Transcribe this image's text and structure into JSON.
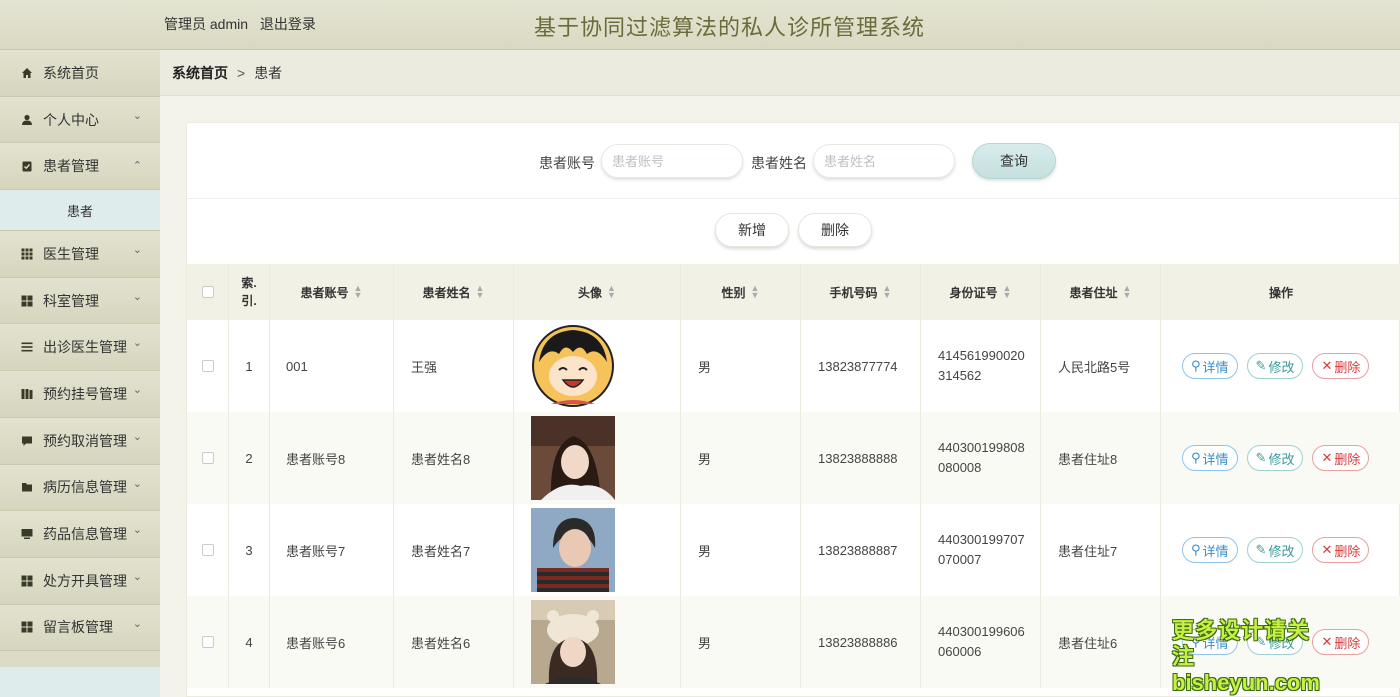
{
  "header": {
    "user_prefix": "管理员 admin",
    "logout": "退出登录",
    "title": "基于协同过滤算法的私人诊所管理系统"
  },
  "sidebar": {
    "items": [
      {
        "label": "系统首页",
        "icon": "home-icon"
      },
      {
        "label": "个人中心",
        "icon": "user-icon"
      },
      {
        "label": "患者管理",
        "icon": "clipboard-icon",
        "expanded": true,
        "sub": "患者"
      },
      {
        "label": "医生管理",
        "icon": "grid-icon"
      },
      {
        "label": "科室管理",
        "icon": "apps-icon"
      },
      {
        "label": "出诊医生管理",
        "icon": "list-icon"
      },
      {
        "label": "预约挂号管理",
        "icon": "book-icon"
      },
      {
        "label": "预约取消管理",
        "icon": "chat-icon"
      },
      {
        "label": "病历信息管理",
        "icon": "folder-icon"
      },
      {
        "label": "药品信息管理",
        "icon": "monitor-icon"
      },
      {
        "label": "处方开具管理",
        "icon": "apps-icon"
      },
      {
        "label": "留言板管理",
        "icon": "apps-icon"
      }
    ]
  },
  "breadcrumb": {
    "home": "系统首页",
    "separator": ">",
    "current": "患者"
  },
  "search": {
    "account_label": "患者账号",
    "account_placeholder": "患者账号",
    "name_label": "患者姓名",
    "name_placeholder": "患者姓名",
    "query_button": "查询"
  },
  "actions": {
    "add": "新增",
    "delete": "删除"
  },
  "table": {
    "columns": [
      "索.\n引.",
      "患者账号",
      "患者姓名",
      "头像",
      "性别",
      "手机号码",
      "身份证号",
      "患者住址",
      "操作"
    ],
    "op_labels": {
      "detail": "详情",
      "edit": "修改",
      "delete": "删除"
    },
    "rows": [
      {
        "index": "1",
        "account": "001",
        "name": "王强",
        "avatar": "cartoon-boy-avatar",
        "gender": "男",
        "phone": "13823877774",
        "id_line1": "414561990020",
        "id_line2": "314562",
        "address": "人民北路5号"
      },
      {
        "index": "2",
        "account": "患者账号8",
        "name": "患者姓名8",
        "avatar": "photo-girl-avatar",
        "gender": "男",
        "phone": "13823888888",
        "id_line1": "440300199808",
        "id_line2": "080008",
        "address": "患者住址8"
      },
      {
        "index": "3",
        "account": "患者账号7",
        "name": "患者姓名7",
        "avatar": "photo-man-striped-avatar",
        "gender": "男",
        "phone": "13823888887",
        "id_line1": "440300199707",
        "id_line2": "070007",
        "address": "患者住址7"
      },
      {
        "index": "4",
        "account": "患者账号6",
        "name": "患者姓名6",
        "avatar": "photo-girl-hat-avatar",
        "gender": "男",
        "phone": "13823888886",
        "id_line1": "440300199606",
        "id_line2": "060006",
        "address": "患者住址6"
      }
    ]
  },
  "watermark": {
    "line1": "更多设计请关注",
    "line2": "bisheyun.com"
  },
  "colors": {
    "sidebar_bg": "#dcdcc6",
    "title_color": "#6b6b3a",
    "sub_active_bg": "#dfecec",
    "query_btn": "#c5dfdf"
  }
}
